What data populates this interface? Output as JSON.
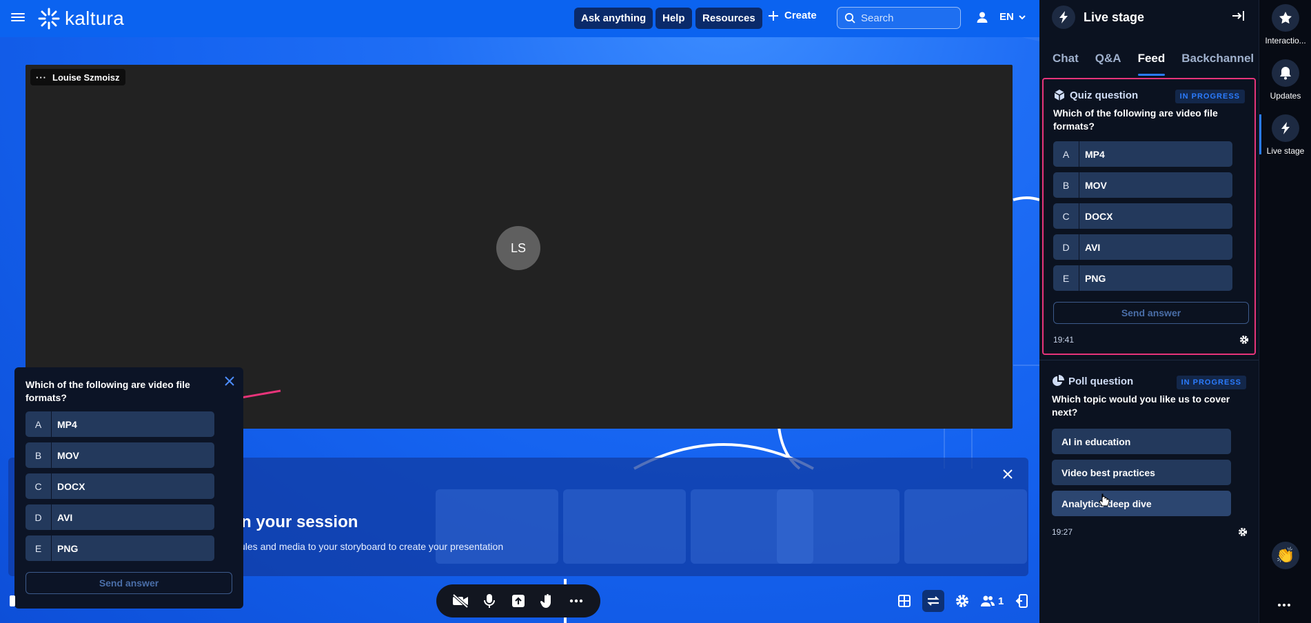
{
  "header": {
    "logo_text": "kaltura",
    "ask_label": "Ask anything",
    "help_label": "Help",
    "resources_label": "Resources",
    "create_label": "Create",
    "search_placeholder": "Search",
    "language": "EN"
  },
  "video": {
    "participant_name": "Louise Szmoisz",
    "initials": "LS"
  },
  "banner": {
    "title": "n your session",
    "subtitle": "ules and media to your storyboard to create your presentation"
  },
  "floating_quiz": {
    "question": "Which of the following are video file formats?",
    "options": [
      {
        "letter": "A",
        "label": "MP4"
      },
      {
        "letter": "B",
        "label": "MOV"
      },
      {
        "letter": "C",
        "label": "DOCX"
      },
      {
        "letter": "D",
        "label": "AVI"
      },
      {
        "letter": "E",
        "label": "PNG"
      }
    ],
    "send_label": "Send answer"
  },
  "controls": {
    "participants_count": "1"
  },
  "panel": {
    "title": "Live stage",
    "tabs": [
      {
        "label": "Chat"
      },
      {
        "label": "Q&A"
      },
      {
        "label": "Feed"
      },
      {
        "label": "Backchannel"
      }
    ],
    "quiz_card": {
      "type_label": "Quiz question",
      "status": "IN PROGRESS",
      "question": "Which of the following are video file formats?",
      "options": [
        {
          "letter": "A",
          "label": "MP4"
        },
        {
          "letter": "B",
          "label": "MOV"
        },
        {
          "letter": "C",
          "label": "DOCX"
        },
        {
          "letter": "D",
          "label": "AVI"
        },
        {
          "letter": "E",
          "label": "PNG"
        }
      ],
      "send_label": "Send answer",
      "time": "19:41"
    },
    "poll_card": {
      "type_label": "Poll question",
      "status": "IN PROGRESS",
      "question": "Which topic would you like us to cover next?",
      "options": [
        {
          "label": "AI in education"
        },
        {
          "label": "Video best practices"
        },
        {
          "label": "Analytics deep dive"
        }
      ],
      "time": "19:27"
    }
  },
  "rail": {
    "interactions_label": "Interactio...",
    "updates_label": "Updates",
    "live_stage_label": "Live stage"
  },
  "colors": {
    "accent": "#2a7bff",
    "highlight_border": "#e8347a",
    "arrow": "#e8347a"
  }
}
